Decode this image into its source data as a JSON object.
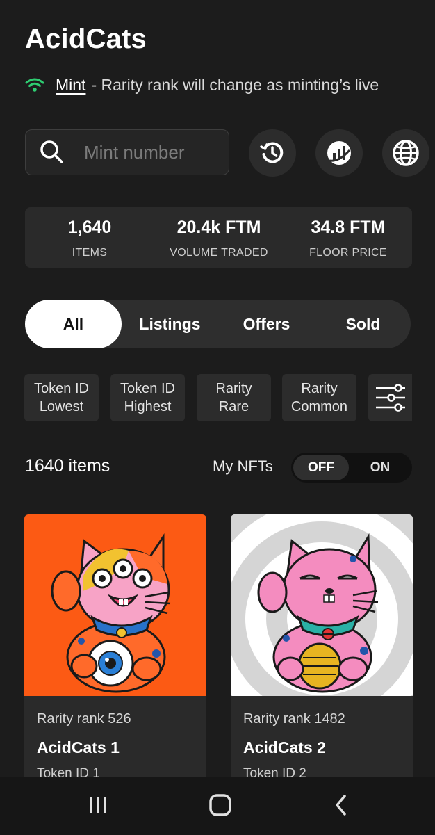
{
  "app": {
    "title": "AcidCats"
  },
  "status": {
    "link_label": "Mint",
    "message": "- Rarity rank will change as minting’s live"
  },
  "search": {
    "placeholder": "Mint number"
  },
  "icons": {
    "wifi": "wifi-icon",
    "search": "search-icon",
    "history": "history-icon",
    "chart": "chart-icon",
    "globe": "globe-icon",
    "filter": "sliders-icon"
  },
  "colors": {
    "background": "#1c1c1c",
    "status_green": "#2ecc71",
    "panel": "#2a2a2a",
    "active_tab": "#ffffff"
  },
  "stats": [
    {
      "value": "1,640",
      "label": "ITEMS"
    },
    {
      "value": "20.4k FTM",
      "label": "VOLUME TRADED"
    },
    {
      "value": "34.8 FTM",
      "label": "FLOOR PRICE"
    }
  ],
  "tabs": [
    {
      "label": "All",
      "active": true
    },
    {
      "label": "Listings",
      "active": false
    },
    {
      "label": "Offers",
      "active": false
    },
    {
      "label": "Sold",
      "active": false
    }
  ],
  "sort_chips": [
    {
      "line1": "Token ID",
      "line2": "Lowest"
    },
    {
      "line1": "Token ID",
      "line2": "Highest"
    },
    {
      "line1": "Rarity",
      "line2": "Rare"
    },
    {
      "line1": "Rarity",
      "line2": "Common"
    }
  ],
  "items_count": "1640 items",
  "my_nfts": {
    "label": "My NFTs",
    "off": "OFF",
    "on": "ON",
    "selected": "OFF"
  },
  "cards": [
    {
      "rank": "Rarity rank 526",
      "name": "AcidCats 1",
      "token": "Token ID 1",
      "bg": "#fc5a14"
    },
    {
      "rank": "Rarity rank 1482",
      "name": "AcidCats 2",
      "token": "Token ID 2",
      "bg": "#ffffff"
    }
  ]
}
